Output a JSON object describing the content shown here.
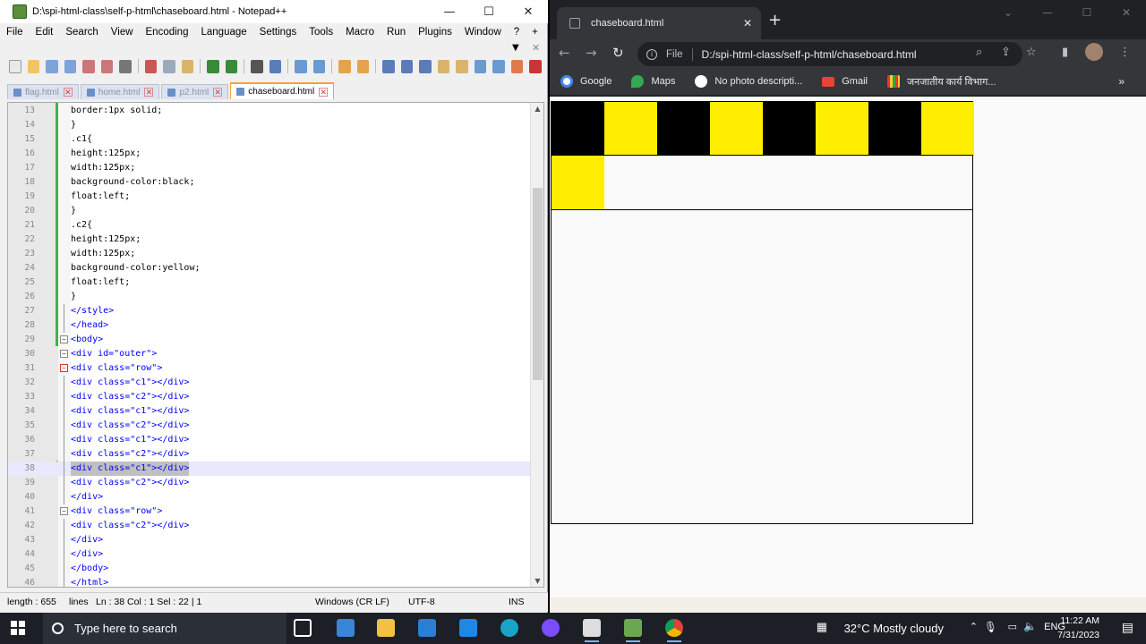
{
  "npp": {
    "title": "D:\\spi-html-class\\self-p-html\\chaseboard.html - Notepad++",
    "menu": [
      "File",
      "Edit",
      "Search",
      "View",
      "Encoding",
      "Language",
      "Settings",
      "Tools",
      "Macro",
      "Run",
      "Plugins",
      "Window",
      "?",
      "+"
    ],
    "tabs": [
      {
        "label": "flag.html",
        "active": false
      },
      {
        "label": "home.html",
        "active": false
      },
      {
        "label": "p2.html",
        "active": false
      },
      {
        "label": "chaseboard.html",
        "active": true
      }
    ],
    "lines": [
      {
        "n": "13",
        "text": "border:1px solid;"
      },
      {
        "n": "14",
        "text": "}"
      },
      {
        "n": "15",
        "text": ".c1{"
      },
      {
        "n": "16",
        "text": "height:125px;"
      },
      {
        "n": "17",
        "text": "width:125px;"
      },
      {
        "n": "18",
        "text": "background-color:black;"
      },
      {
        "n": "19",
        "text": "float:left;"
      },
      {
        "n": "20",
        "text": "}"
      },
      {
        "n": "21",
        "text": ".c2{"
      },
      {
        "n": "22",
        "text": "height:125px;"
      },
      {
        "n": "23",
        "text": "width:125px;"
      },
      {
        "n": "24",
        "text": "background-color:yellow;"
      },
      {
        "n": "25",
        "text": "float:left;"
      },
      {
        "n": "26",
        "text": "}"
      },
      {
        "n": "27",
        "text": "</style>"
      },
      {
        "n": "28",
        "text": "</head>"
      },
      {
        "n": "29",
        "text": "<body>"
      },
      {
        "n": "30",
        "text": "<div id=\"outer\">"
      },
      {
        "n": "31",
        "text": "<div class=\"row\">"
      },
      {
        "n": "32",
        "text": "<div class=\"c1\"></div>"
      },
      {
        "n": "33",
        "text": "<div class=\"c2\"></div>"
      },
      {
        "n": "34",
        "text": "<div class=\"c1\"></div>"
      },
      {
        "n": "35",
        "text": "<div class=\"c2\"></div>"
      },
      {
        "n": "36",
        "text": "<div class=\"c1\"></div>"
      },
      {
        "n": "37",
        "text": "<div class=\"c2\"></div>"
      },
      {
        "n": "38",
        "text": "<div class=\"c1\"></div>"
      },
      {
        "n": "39",
        "text": "<div class=\"c2\"></div>"
      },
      {
        "n": "40",
        "text": "</div>"
      },
      {
        "n": "41",
        "text": "<div class=\"row\">"
      },
      {
        "n": "42",
        "text": "<div class=\"c2\"></div>"
      },
      {
        "n": "43",
        "text": "</div>"
      },
      {
        "n": "44",
        "text": "</div>"
      },
      {
        "n": "45",
        "text": "</body>"
      },
      {
        "n": "46",
        "text": "</html>"
      }
    ],
    "current_line": "38",
    "status": {
      "length": "length : 655",
      "lines": "lines",
      "pos": "Ln : 38    Col : 1    Sel : 22 | 1",
      "eol": "Windows (CR LF)",
      "encoding": "UTF-8",
      "mode": "INS"
    }
  },
  "chrome": {
    "tab_title": "chaseboard.html",
    "scheme": "File",
    "url": "D:/spi-html-class/self-p-html/chaseboard.html",
    "bookmarks": [
      {
        "label": "Google",
        "icon": "google-icon"
      },
      {
        "label": "Maps",
        "icon": "maps-icon"
      },
      {
        "label": "No photo descripti...",
        "icon": "github-icon"
      },
      {
        "label": "Gmail",
        "icon": "gmail-icon"
      },
      {
        "label": "जनजातीय कार्य विभाग...",
        "icon": "emblem-icon"
      }
    ],
    "board": {
      "row1": [
        "black",
        "yellow",
        "black",
        "yellow",
        "black",
        "yellow",
        "black",
        "yellow"
      ],
      "row2": [
        "yellow"
      ]
    },
    "colors": {
      "black": "#000000",
      "yellow": "#ffee00"
    }
  },
  "taskbar": {
    "search_placeholder": "Type here to search",
    "weather": "32°C  Mostly cloudy",
    "lang": "ENG",
    "time": "11:22 AM",
    "date": "7/31/2023"
  }
}
